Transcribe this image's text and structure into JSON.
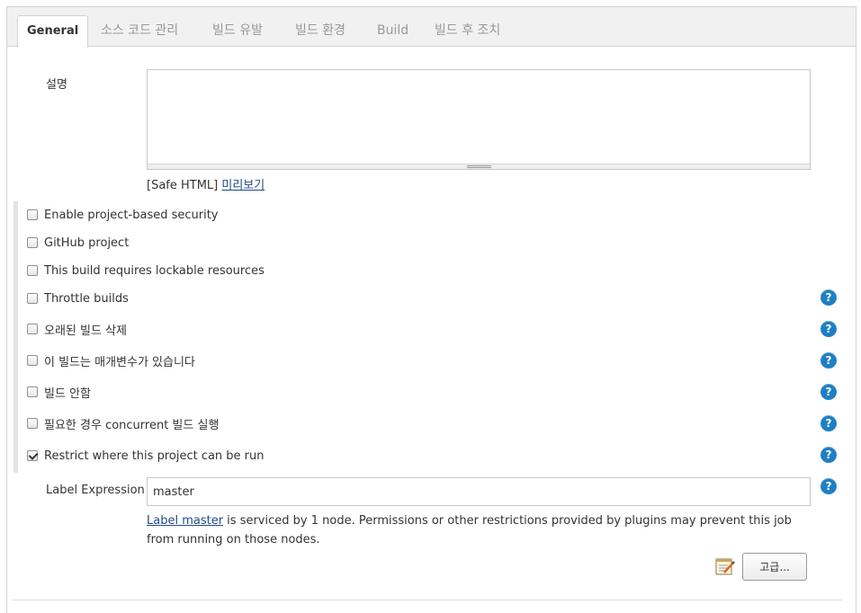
{
  "tabs": [
    {
      "label": "General",
      "active": true
    },
    {
      "label": "소스 코드 관리",
      "active": false
    },
    {
      "label": "빌드 유발",
      "active": false
    },
    {
      "label": "빌드 환경",
      "active": false
    },
    {
      "label": "Build",
      "active": false
    },
    {
      "label": "빌드 후 조치",
      "active": false
    }
  ],
  "description": {
    "label": "설명",
    "value": "",
    "safe_html_prefix": "[Safe HTML]",
    "preview_link": "미리보기"
  },
  "options": [
    {
      "label": "Enable project-based security",
      "checked": false,
      "help": false
    },
    {
      "label": "GitHub project",
      "checked": false,
      "help": false
    },
    {
      "label": "This build requires lockable resources",
      "checked": false,
      "help": false
    },
    {
      "label": "Throttle builds",
      "checked": false,
      "help": true
    },
    {
      "label": "오래된 빌드 삭제",
      "checked": false,
      "help": true
    },
    {
      "label": "이 빌드는 매개변수가 있습니다",
      "checked": false,
      "help": true
    },
    {
      "label": "빌드 안함",
      "checked": false,
      "help": true
    },
    {
      "label": "필요한 경우 concurrent 빌드 실행",
      "checked": false,
      "help": true
    },
    {
      "label": "Restrict where this project can be run",
      "checked": true,
      "help": true
    }
  ],
  "label_expression": {
    "label": "Label Expression",
    "value": "master",
    "info_link": "Label master",
    "info_text": " is serviced by 1 node. Permissions or other restrictions provided by plugins may prevent this job from running on those nodes."
  },
  "help_glyph": "?",
  "advanced_button": "고급...",
  "colors": {
    "help_blue": "#1f7fc4",
    "link": "#204a87",
    "tabbar_bg": "#f1f1f1"
  },
  "icons": {
    "help": "help-icon",
    "notepad": "notepad-icon",
    "checkbox": "checkbox"
  }
}
